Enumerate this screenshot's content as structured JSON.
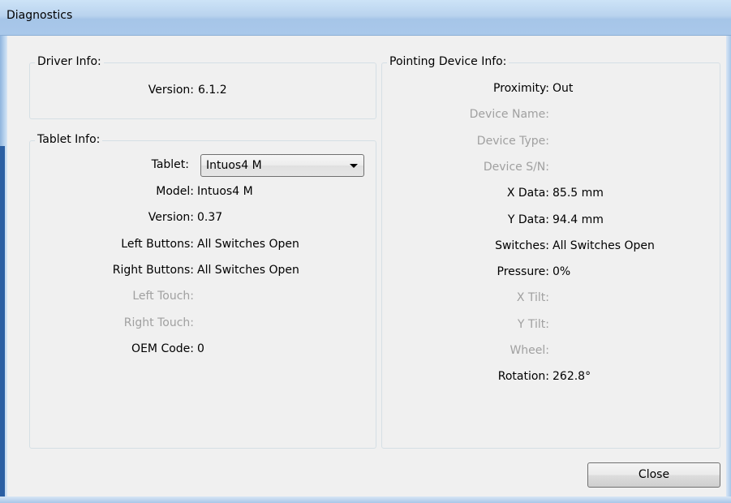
{
  "window": {
    "title": "Diagnostics"
  },
  "driver_info": {
    "heading": "Driver Info:",
    "version_label": "Version:",
    "version_value": "6.1.2"
  },
  "tablet_info": {
    "heading": "Tablet Info:",
    "tablet_label": "Tablet:",
    "tablet_selected": "Intuos4 M",
    "rows": [
      {
        "label": "Model:",
        "value": "Intuos4 M",
        "enabled": true
      },
      {
        "label": "Version:",
        "value": "0.37",
        "enabled": true
      },
      {
        "label": "Left Buttons:",
        "value": "All Switches Open",
        "enabled": true
      },
      {
        "label": "Right Buttons:",
        "value": "All Switches Open",
        "enabled": true
      },
      {
        "label": "Left Touch:",
        "value": "",
        "enabled": false
      },
      {
        "label": "Right Touch:",
        "value": "",
        "enabled": false
      },
      {
        "label": "OEM Code:",
        "value": "0",
        "enabled": true
      }
    ]
  },
  "pointing_device_info": {
    "heading": "Pointing Device Info:",
    "rows": [
      {
        "label": "Proximity:",
        "value": "Out",
        "enabled": true
      },
      {
        "label": "Device Name:",
        "value": "",
        "enabled": false
      },
      {
        "label": "Device Type:",
        "value": "",
        "enabled": false
      },
      {
        "label": "Device S/N:",
        "value": "",
        "enabled": false
      },
      {
        "label": "X Data:",
        "value": "85.5 mm",
        "enabled": true
      },
      {
        "label": "Y Data:",
        "value": "94.4 mm",
        "enabled": true
      },
      {
        "label": "Switches:",
        "value": "All Switches Open",
        "enabled": true
      },
      {
        "label": "Pressure:",
        "value": "0%",
        "enabled": true
      },
      {
        "label": "X Tilt:",
        "value": "",
        "enabled": false
      },
      {
        "label": "Y Tilt:",
        "value": "",
        "enabled": false
      },
      {
        "label": "Wheel:",
        "value": "",
        "enabled": false
      },
      {
        "label": "Rotation:",
        "value": "262.8°",
        "enabled": true
      }
    ]
  },
  "buttons": {
    "close_label": "Close"
  }
}
